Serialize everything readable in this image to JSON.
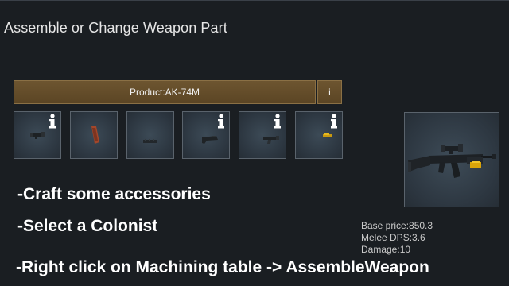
{
  "window": {
    "title": "Assemble or Change Weapon Part"
  },
  "product": {
    "label": "Product:AK-74M",
    "info_label": "i"
  },
  "parts": [
    {
      "name": "scope-part-icon"
    },
    {
      "name": "magazine-part-icon"
    },
    {
      "name": "rail-part-icon"
    },
    {
      "name": "stock-part-icon"
    },
    {
      "name": "grip-part-icon"
    },
    {
      "name": "ammo-part-icon"
    }
  ],
  "instructions": [
    "-Craft some accessories",
    "-Select a Colonist",
    "-Right click on Machining table -> AssembleWeapon"
  ],
  "stats": {
    "base_price": "Base price:850.3",
    "melee_dps": "Melee DPS:3.6",
    "damage": "Damage:10"
  },
  "colors": {
    "button_bg": "#6d5530",
    "slot_bg": "#2c3640",
    "panel_bg": "#1a1e22",
    "accent_gold": "#e0a800",
    "rust_red": "#a3472a"
  }
}
